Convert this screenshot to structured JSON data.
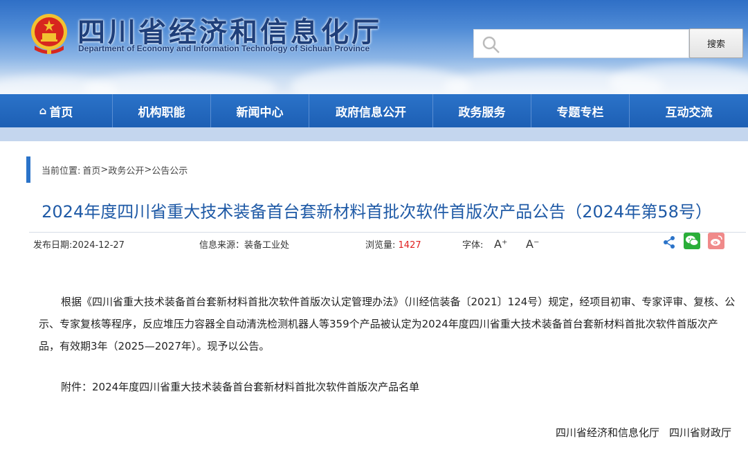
{
  "header": {
    "title": "四川省经济和信息化厅",
    "subtitle": "Department of Economy and Information Technology of Sichuan Province",
    "emblem_icon": "national-emblem-icon"
  },
  "search": {
    "placeholder": "",
    "value": "",
    "button_label": "搜索"
  },
  "nav": {
    "home_glyph": "⌂",
    "items": [
      "首页",
      "机构职能",
      "新闻中心",
      "政府信息公开",
      "政务服务",
      "专题专栏",
      "互动交流"
    ]
  },
  "breadcrumb": {
    "prefix": "当前位置:",
    "items": [
      "首页",
      "政务公开",
      "公告公示"
    ],
    "separator": ">"
  },
  "article": {
    "title": "2024年度四川省重大技术装备首台套新材料首批次软件首版次产品公告（2024年第58号）",
    "meta": {
      "date_label": "发布日期:",
      "date": "2024-12-27",
      "source_label": "信息来源：",
      "source": "装备工业处",
      "views_label": "浏览量:",
      "views": "1427",
      "font_label": "字体:",
      "font_increase": "A⁺",
      "font_decrease": "A⁻"
    },
    "share_icons": [
      "share-icon",
      "wechat-icon",
      "weibo-icon"
    ],
    "body": "根据《四川省重大技术装备首台套新材料首批次软件首版次认定管理办法》（川经信装备〔2021〕124号）规定，经项目初审、专家评审、复核、公示、专家复核等程序，反应堆压力容器全自动清洗检测机器人等359个产品被认定为2024年度四川省重大技术装备首台套新材料首批次软件首版次产品，有效期3年（2025—2027年）。现予以公告。",
    "attachment": "附件：2024年度四川省重大技术装备首台套新材料首批次软件首版次产品名单",
    "signatures": [
      "四川省经济和信息化厅",
      "四川省财政厅"
    ]
  },
  "colors": {
    "nav_blue": "#1d5fb4",
    "title_blue": "#1f5aa6",
    "views_red": "#e02020"
  }
}
